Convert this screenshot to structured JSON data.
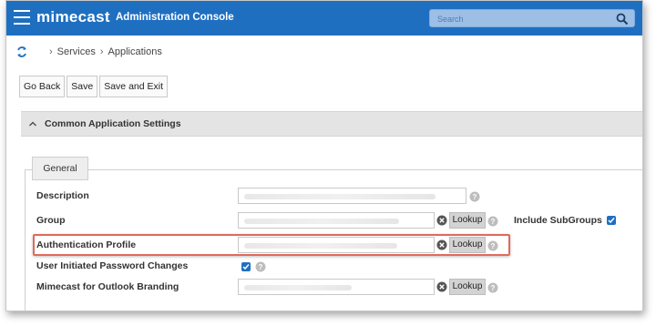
{
  "header": {
    "brand": "mimecast",
    "console_title": "Administration Console",
    "search_placeholder": "Search"
  },
  "breadcrumb": {
    "items": [
      "Services",
      "Applications"
    ]
  },
  "toolbar": {
    "go_back": "Go Back",
    "save": "Save",
    "save_exit": "Save and Exit"
  },
  "section": {
    "title": "Common Application Settings",
    "tab": "General"
  },
  "form": {
    "description_label": "Description",
    "group_label": "Group",
    "include_subgroups_label": "Include SubGroups",
    "auth_profile_label": "Authentication Profile",
    "user_pw_label": "User Initiated Password Changes",
    "outlook_branding_label": "Mimecast for Outlook Branding",
    "lookup": "Lookup"
  },
  "colors": {
    "topbar": "#1f6fc1",
    "highlight": "#e06a5a"
  }
}
